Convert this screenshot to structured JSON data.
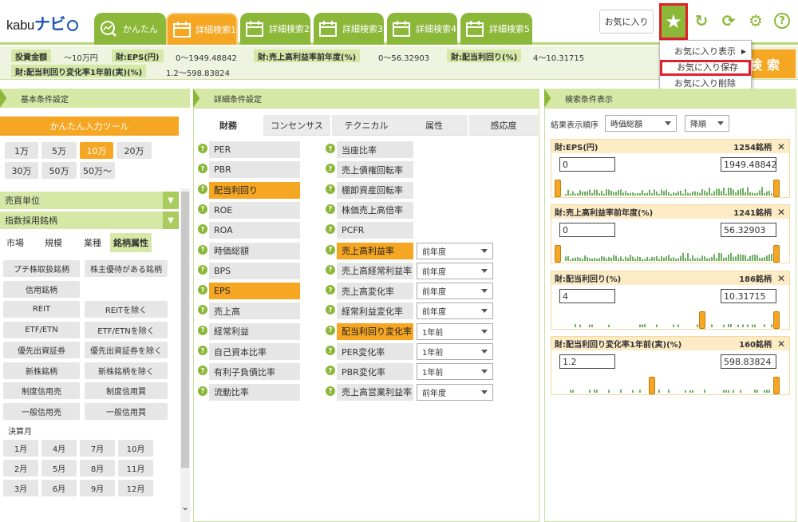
{
  "header": {
    "logo_kabu": "kabu",
    "logo_navi": "ナビ",
    "tabs": [
      {
        "label": "かんたん",
        "icon": "search-chart-icon",
        "active": false
      },
      {
        "label": "詳細検索1",
        "icon": "calendar-icon",
        "active": true
      },
      {
        "label": "詳細検索2",
        "icon": "calendar-icon",
        "active": false
      },
      {
        "label": "詳細検索3",
        "icon": "calendar-icon",
        "active": false
      },
      {
        "label": "詳細検索4",
        "icon": "calendar-icon",
        "active": false
      },
      {
        "label": "詳細検索5",
        "icon": "calendar-icon",
        "active": false
      }
    ],
    "favorites_label": "お気に入り",
    "accent_color": "#8cb83a",
    "active_color": "#f5a623",
    "highlight_color": "#e0202a"
  },
  "favorites_menu": {
    "items": [
      {
        "label": "お気に入り表示",
        "has_submenu": true
      },
      {
        "label": "お気に入り保存",
        "highlighted": true
      },
      {
        "label": "お気に入り削除"
      }
    ]
  },
  "conditions": {
    "row1": [
      {
        "label": "投資金額",
        "value": "〜10万円"
      },
      {
        "label": "財:EPS(円)",
        "value": "0〜1949.48842"
      },
      {
        "label": "財:売上高利益率前年度(%)",
        "value": "0〜56.32903"
      },
      {
        "label": "財:配当利回り(%)",
        "value": "4〜10.31715"
      }
    ],
    "row2": [
      {
        "label": "財:配当利回り変化率1年前(実)(%)",
        "value": "1.2〜598.83824"
      }
    ],
    "search_label": "検索"
  },
  "basic": {
    "title": "基本条件設定",
    "easy_tool": "かんたん入力ツール",
    "amounts": [
      "1万",
      "5万",
      "10万",
      "20万",
      "30万",
      "50万",
      "50万〜"
    ],
    "selected_amount": "10万",
    "sections": [
      "売買単位",
      "指数採用銘柄"
    ],
    "subtabs": [
      "市場",
      "規模",
      "業種",
      "銘柄属性"
    ],
    "active_subtab": "銘柄属性",
    "attr_buttons": [
      [
        "プチ株取扱銘柄",
        "株主優待がある銘柄"
      ],
      [
        "信用銘柄",
        ""
      ],
      [
        "REIT",
        "REITを除く"
      ],
      [
        "ETF/ETN",
        "ETF/ETNを除く"
      ],
      [
        "優先出資証券",
        "優先出資証券を除く"
      ],
      [
        "新株銘柄",
        "新株銘柄を除く"
      ],
      [
        "制度信用売",
        "制度信用買"
      ],
      [
        "一般信用売",
        "一般信用買"
      ]
    ],
    "settlement_label": "決算月",
    "months": [
      [
        "1月",
        "4月",
        "7月",
        "10月"
      ],
      [
        "2月",
        "5月",
        "8月",
        "11月"
      ],
      [
        "3月",
        "6月",
        "9月",
        "12月"
      ]
    ]
  },
  "detail": {
    "title": "詳細条件設定",
    "tabs": [
      "財務",
      "コンセンサス",
      "テクニカル",
      "属性",
      "感応度"
    ],
    "active_tab": "財務",
    "left_items": [
      {
        "label": "PER",
        "selected": false
      },
      {
        "label": "PBR",
        "selected": false
      },
      {
        "label": "配当利回り",
        "selected": true
      },
      {
        "label": "ROE",
        "selected": false
      },
      {
        "label": "ROA",
        "selected": false
      },
      {
        "label": "時価総額",
        "selected": false
      },
      {
        "label": "BPS",
        "selected": false
      },
      {
        "label": "EPS",
        "selected": true
      },
      {
        "label": "売上高",
        "selected": false
      },
      {
        "label": "経常利益",
        "selected": false
      },
      {
        "label": "自己資本比率",
        "selected": false
      },
      {
        "label": "有利子負債比率",
        "selected": false
      },
      {
        "label": "流動比率",
        "selected": false
      }
    ],
    "right_items": [
      {
        "label": "当座比率",
        "selected": false,
        "period": ""
      },
      {
        "label": "売上債権回転率",
        "selected": false,
        "period": ""
      },
      {
        "label": "棚卸資産回転率",
        "selected": false,
        "period": ""
      },
      {
        "label": "株価売上高倍率",
        "selected": false,
        "period": ""
      },
      {
        "label": "PCFR",
        "selected": false,
        "period": ""
      },
      {
        "label": "売上高利益率",
        "selected": true,
        "period": "前年度"
      },
      {
        "label": "売上高経常利益率",
        "selected": false,
        "period": "前年度"
      },
      {
        "label": "売上高変化率",
        "selected": false,
        "period": "前年度"
      },
      {
        "label": "経常利益変化率",
        "selected": false,
        "period": "前年度"
      },
      {
        "label": "配当利回り変化率",
        "selected": true,
        "period": "1年前"
      },
      {
        "label": "PER変化率",
        "selected": false,
        "period": "1年前"
      },
      {
        "label": "PBR変化率",
        "selected": false,
        "period": "1年前"
      },
      {
        "label": "売上高営業利益率",
        "selected": false,
        "period": "前年度"
      }
    ]
  },
  "results": {
    "title": "検索条件表示",
    "sort_label": "結果表示順序",
    "sort_value": "時価総額",
    "order_value": "降順",
    "cards": [
      {
        "title": "財:EPS(円)",
        "count": "1254銘柄",
        "min": "0",
        "max": "1949.48842",
        "knob_left": 0.0,
        "knob_right": 1.0
      },
      {
        "title": "財:売上高利益率前年度(%)",
        "count": "1241銘柄",
        "min": "0",
        "max": "56.32903",
        "knob_left": 0.0,
        "knob_right": 1.0
      },
      {
        "title": "財:配当利回り(%)",
        "count": "186銘柄",
        "min": "4",
        "max": "10.31715",
        "knob_left": 0.66,
        "knob_right": 1.0
      },
      {
        "title": "財:配当利回り変化率1年前(実)(%)",
        "count": "160銘柄",
        "min": "1.2",
        "max": "598.83824",
        "knob_left": 0.43,
        "knob_right": 1.0
      }
    ]
  }
}
